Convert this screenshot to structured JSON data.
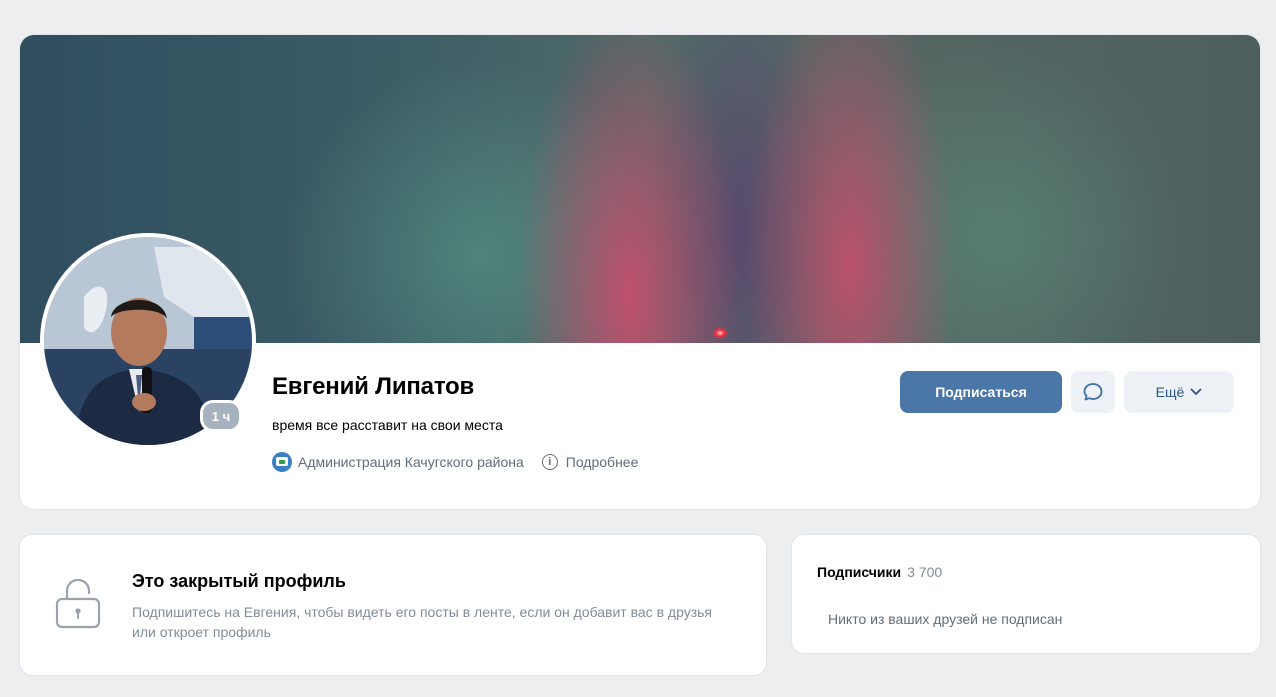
{
  "profile": {
    "name": "Евгений Липатов",
    "status": "время все расставит на свои места",
    "online_badge": "1 ч",
    "organization": "Администрация Качугского района",
    "details_label": "Подробнее",
    "info_glyph": "i",
    "org_icon": "organization-logo-icon"
  },
  "actions": {
    "subscribe_label": "Подписаться",
    "message_icon": "message-bubble-icon",
    "more_label": "Ещё",
    "more_icon": "chevron-down-icon"
  },
  "closed_profile": {
    "icon": "lock-icon",
    "title": "Это закрытый профиль",
    "text": "Подпишитесь на Евгения, чтобы видеть его посты в ленте, если он добавит вас в друзья или откроет профиль"
  },
  "followers": {
    "title": "Подписчики",
    "count": "3 700",
    "empty_text": "Никто из ваших друзей не подписан"
  },
  "colors": {
    "accent": "#4a76a8",
    "link": "#2a5885",
    "secondary_text": "#818c99",
    "background": "#edeef0"
  }
}
